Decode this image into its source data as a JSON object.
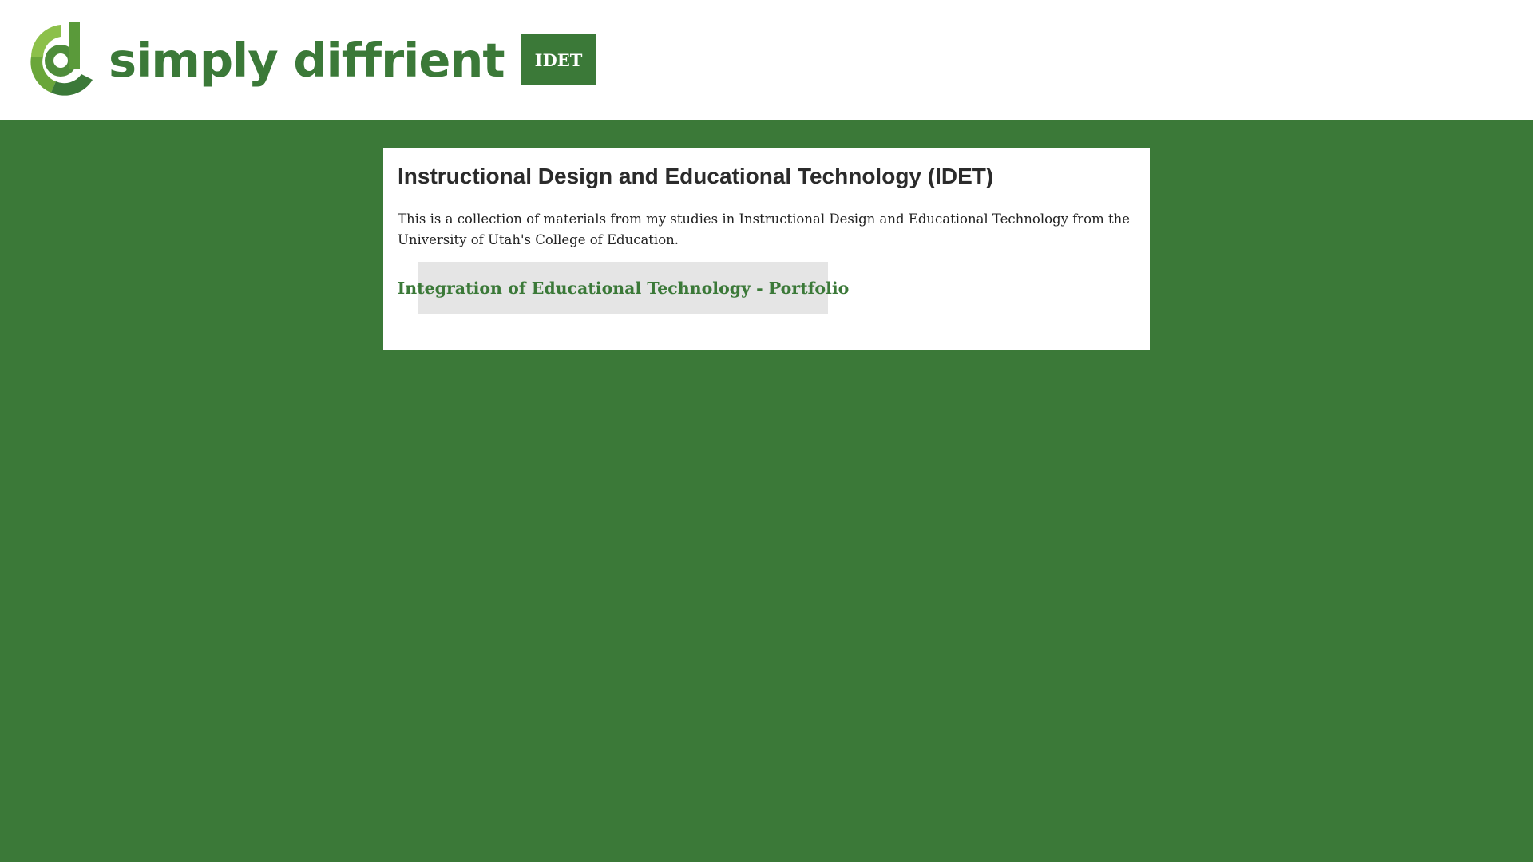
{
  "header": {
    "brand_name": "simply diffrient",
    "logo_icon": "d-letter-ring-logo-icon",
    "nav_button_label": "IDET"
  },
  "main": {
    "title": "Instructional Design and Educational Technology (IDET)",
    "description": "This is a collection of materials from my studies in Instructional Design and Educational Technology from the University of Utah's College of Education.",
    "links": [
      {
        "label": "Integration of Educational Technology - Portfolio"
      }
    ]
  },
  "colors": {
    "brand_green": "#3b7938",
    "light_green": "#8cc04a",
    "mid_green": "#6aa63a",
    "header_background": "#ffffff",
    "link_background": "#e5e5e5",
    "title_text": "#2b2b2b"
  }
}
